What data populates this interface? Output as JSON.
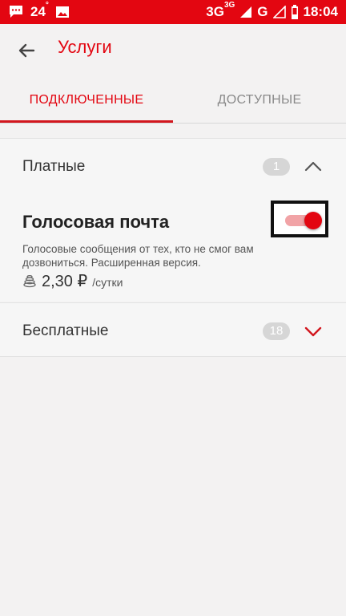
{
  "status_bar": {
    "temperature": "24",
    "temperature_unit": "°",
    "network_left": "3G",
    "network_sup": "3G",
    "network_right": "G",
    "time": "18:04",
    "icons": [
      "message-icon",
      "image-icon",
      "signal-icon",
      "battery-icon"
    ]
  },
  "header": {
    "title": "Услуги",
    "back_icon": "arrow-left-icon"
  },
  "tabs": [
    {
      "label": "ПОДКЛЮЧЕННЫЕ",
      "active": true
    },
    {
      "label": "ДОСТУПНЫЕ",
      "active": false
    }
  ],
  "sections": {
    "paid": {
      "title": "Платные",
      "count": "1",
      "expanded": true
    },
    "free": {
      "title": "Бесплатные",
      "count": "18",
      "expanded": false
    }
  },
  "service": {
    "name": "Голосовая почта",
    "description": "Голосовые сообщения от тех, кто не смог вам дозвониться. Расширенная версия.",
    "price": "2,30 ₽",
    "price_unit": "/сутки",
    "enabled": true
  },
  "colors": {
    "brand_red": "#e30611",
    "badge_gray": "#d6d6d6",
    "background": "#f3f2f2"
  }
}
